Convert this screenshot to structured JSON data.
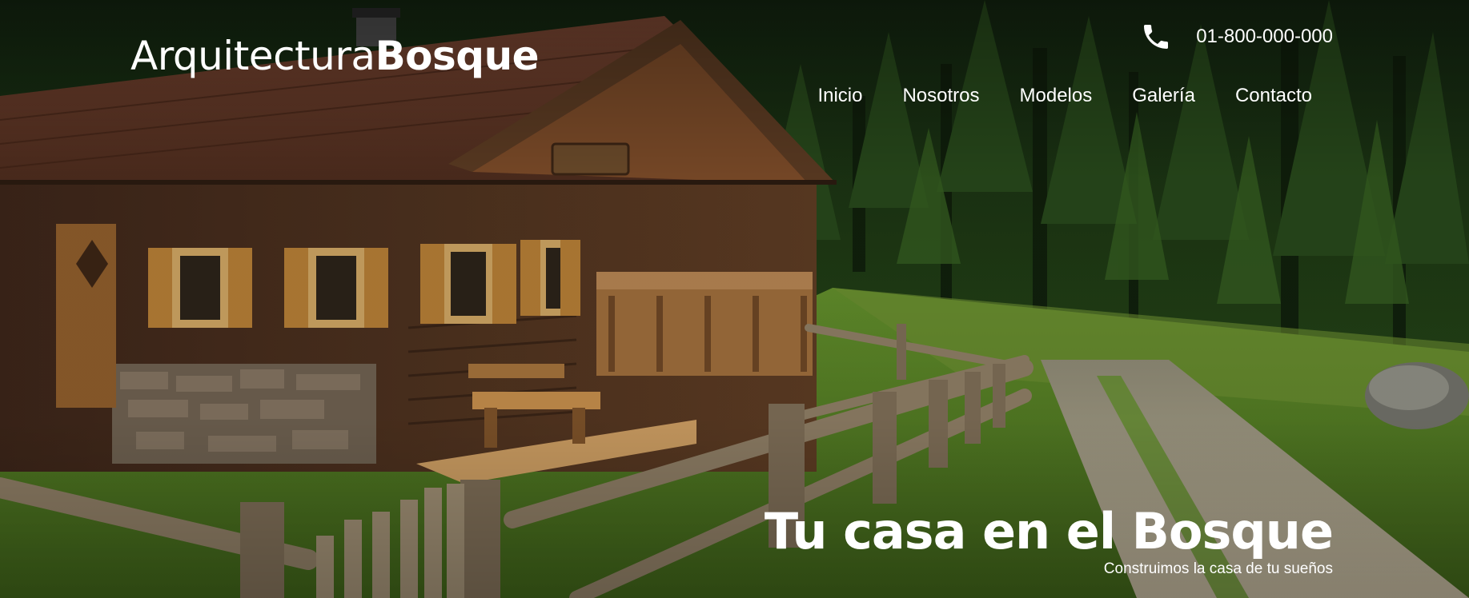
{
  "header": {
    "logo_light": "Arquitectura",
    "logo_bold": "Bosque",
    "phone_icon": "phone-icon",
    "phone_number": "01-800-000-000"
  },
  "nav": {
    "items": [
      {
        "label": "Inicio"
      },
      {
        "label": "Nosotros"
      },
      {
        "label": "Modelos"
      },
      {
        "label": "Galería"
      },
      {
        "label": "Contacto"
      }
    ]
  },
  "hero": {
    "title": "Tu casa en el Bosque",
    "subtitle": "Construimos la casa de tu sueños"
  },
  "colors": {
    "text": "#ffffff",
    "forest": "#1e3a14",
    "grass": "#4f7a22",
    "wood": "#6b4a2a",
    "roof": "#6a3a2a"
  }
}
